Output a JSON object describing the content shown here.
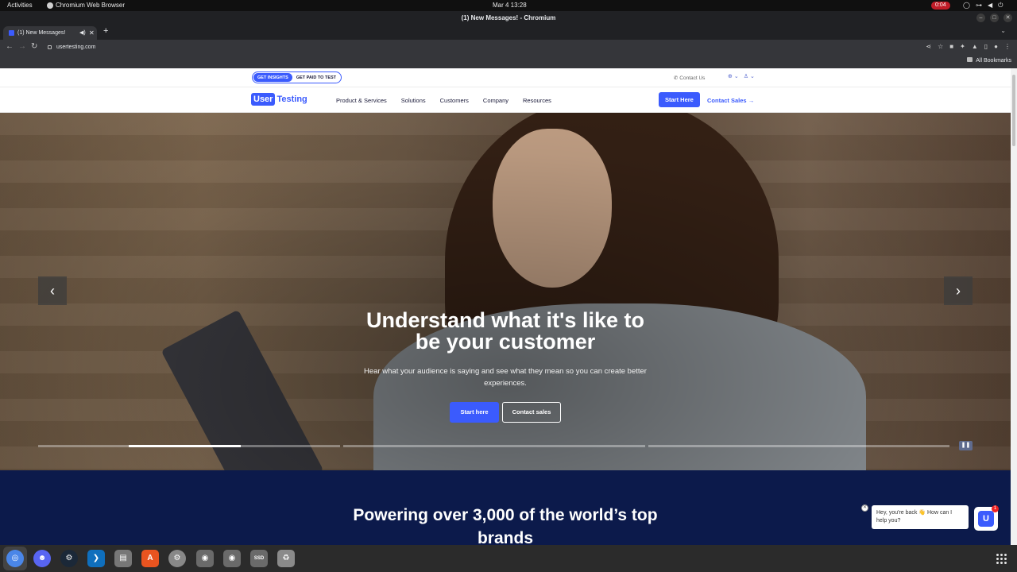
{
  "system": {
    "activities": "Activities",
    "app_name": "Chromium Web Browser",
    "clock": "Mar 4  13:28",
    "recording": "0:04"
  },
  "browser": {
    "window_title": "(1) New Messages! - Chromium",
    "tab_title": "(1) New Messages!",
    "url": "usertesting.com",
    "all_bookmarks": "All Bookmarks"
  },
  "site": {
    "toggle": {
      "insights": "GET INSIGHTS",
      "paid": "GET PAID TO TEST"
    },
    "contact_us": "Contact Us",
    "logo": {
      "user": "User",
      "testing": "Testing"
    },
    "nav": [
      "Product & Services",
      "Solutions",
      "Customers",
      "Company",
      "Resources"
    ],
    "start_here": "Start Here",
    "contact_sales": "Contact Sales",
    "hero": {
      "headline_line1": "Understand what it's like to",
      "headline_line2": "be your customer",
      "subtext": "Hear what your audience is saying and see what they mean so you can create better experiences.",
      "cta_primary": "Start here",
      "cta_secondary": "Contact sales",
      "slide_progress": [
        1.0,
        0.0,
        0.0
      ],
      "current_slide_fill": 0.37
    },
    "brands_heading": "Powering over 3,000 of the world’s top brands",
    "chat": {
      "message": "Hey, you're back 👋 How can I help you?",
      "badge": "1"
    }
  },
  "dock": {
    "apps": [
      "chromium-icon",
      "discord-icon",
      "steam-icon",
      "vscode-icon",
      "files-icon",
      "software-center-icon",
      "settings-icon",
      "disk-icon",
      "disk-icon-2",
      "ssd-icon",
      "trash-icon"
    ],
    "ssd_label": "SSD"
  },
  "colors": {
    "brand_blue": "#3b5bfd",
    "navy": "#0c1a4b",
    "recording_red": "#c01c28"
  }
}
